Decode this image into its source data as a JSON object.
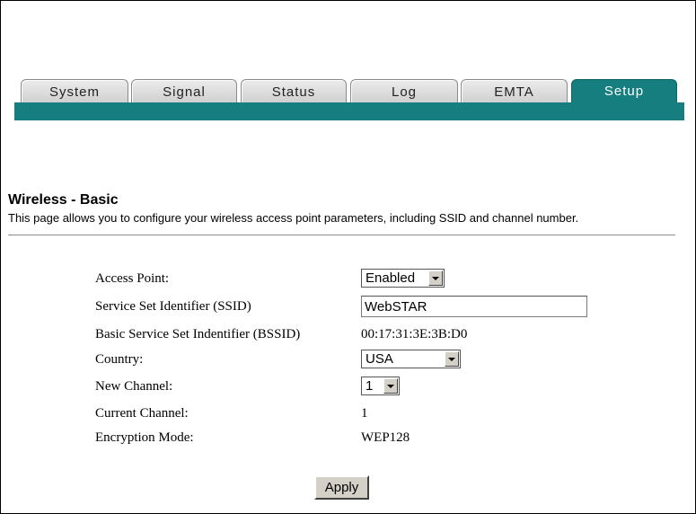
{
  "tabs": [
    {
      "label": "System",
      "active": false
    },
    {
      "label": "Signal",
      "active": false
    },
    {
      "label": "Status",
      "active": false
    },
    {
      "label": "Log",
      "active": false
    },
    {
      "label": "EMTA",
      "active": false
    },
    {
      "label": "Setup",
      "active": true
    }
  ],
  "colors": {
    "accent": "#167e7e"
  },
  "page": {
    "title": "Wireless - Basic",
    "description": "This page allows you to configure your wireless access point parameters, including SSID and channel number."
  },
  "form": {
    "access_point": {
      "label": "Access Point:",
      "value": "Enabled"
    },
    "ssid": {
      "label": "Service Set Identifier (SSID)",
      "value": "WebSTAR"
    },
    "bssid": {
      "label": "Basic Service Set Indentifier (BSSID)",
      "value": "00:17:31:3E:3B:D0"
    },
    "country": {
      "label": "Country:",
      "value": "USA"
    },
    "new_channel": {
      "label": "New Channel:",
      "value": "1"
    },
    "current_channel": {
      "label": "Current Channel:",
      "value": "1"
    },
    "encryption_mode": {
      "label": "Encryption Mode:",
      "value": "WEP128"
    }
  },
  "apply_label": "Apply"
}
